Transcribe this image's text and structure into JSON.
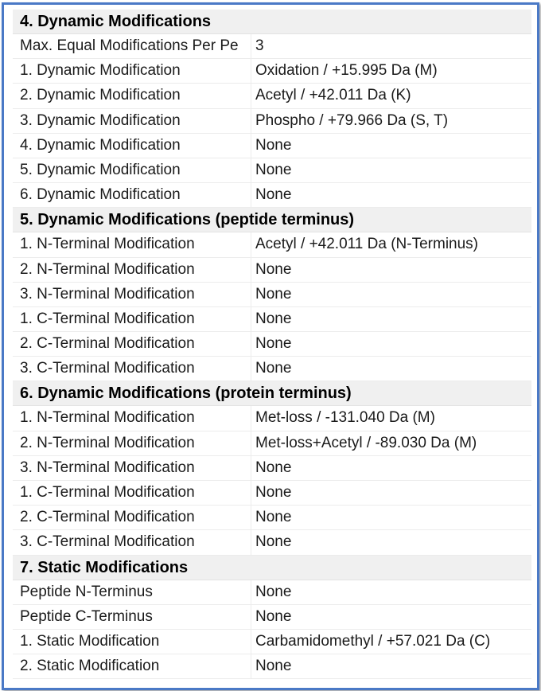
{
  "sections": [
    {
      "title": "4. Dynamic Modifications",
      "rows": [
        {
          "name": "Max. Equal Modifications Per Pe",
          "value": "3"
        },
        {
          "name": "1. Dynamic Modification",
          "value": "Oxidation / +15.995 Da (M)"
        },
        {
          "name": "2. Dynamic Modification",
          "value": "Acetyl / +42.011 Da (K)"
        },
        {
          "name": "3. Dynamic Modification",
          "value": "Phospho / +79.966 Da (S, T)"
        },
        {
          "name": "4. Dynamic Modification",
          "value": "None"
        },
        {
          "name": "5. Dynamic Modification",
          "value": "None"
        },
        {
          "name": "6. Dynamic Modification",
          "value": "None"
        }
      ]
    },
    {
      "title": "5. Dynamic Modifications (peptide terminus)",
      "rows": [
        {
          "name": "1. N-Terminal Modification",
          "value": "Acetyl / +42.011 Da (N-Terminus)"
        },
        {
          "name": "2. N-Terminal Modification",
          "value": "None"
        },
        {
          "name": "3. N-Terminal Modification",
          "value": "None"
        },
        {
          "name": "1. C-Terminal Modification",
          "value": "None"
        },
        {
          "name": "2. C-Terminal Modification",
          "value": "None"
        },
        {
          "name": "3. C-Terminal Modification",
          "value": "None"
        }
      ]
    },
    {
      "title": "6. Dynamic Modifications (protein terminus)",
      "rows": [
        {
          "name": "1. N-Terminal Modification",
          "value": "Met-loss / -131.040 Da (M)"
        },
        {
          "name": "2. N-Terminal Modification",
          "value": "Met-loss+Acetyl / -89.030 Da (M)"
        },
        {
          "name": "3. N-Terminal Modification",
          "value": "None"
        },
        {
          "name": "1. C-Terminal Modification",
          "value": "None"
        },
        {
          "name": "2. C-Terminal Modification",
          "value": "None"
        },
        {
          "name": "3. C-Terminal Modification",
          "value": "None"
        }
      ]
    },
    {
      "title": "7. Static Modifications",
      "rows": [
        {
          "name": "Peptide N-Terminus",
          "value": "None"
        },
        {
          "name": "Peptide C-Terminus",
          "value": "None"
        },
        {
          "name": "1. Static Modification",
          "value": "Carbamidomethyl / +57.021 Da (C)"
        },
        {
          "name": "2. Static Modification",
          "value": "None"
        }
      ]
    }
  ],
  "colors": {
    "frame_border": "#4a79c6",
    "section_header_bg": "#f0f0f0",
    "grid_line": "#ececec"
  }
}
